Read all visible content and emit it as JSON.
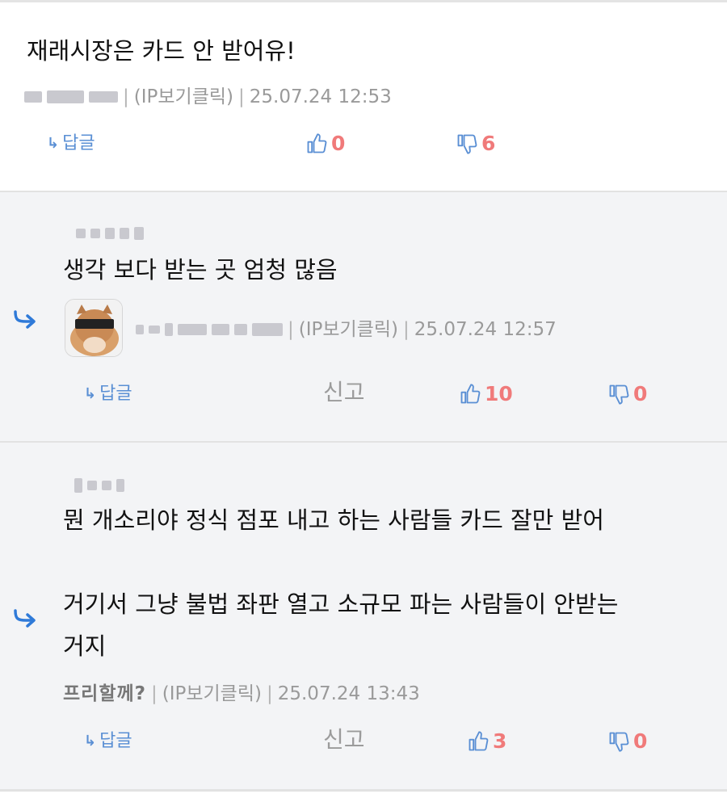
{
  "comments": [
    {
      "text": "재래시장은 카드 안 받어유!",
      "ip": "(IP보기클릭)",
      "date": "25.07.24 12:53",
      "reply": "답글",
      "likes": "0",
      "dislikes": "6"
    },
    {
      "text": "생각 보다 받는 곳 엄청 많음",
      "ip": "(IP보기클릭)",
      "date": "25.07.24 12:57",
      "reply": "답글",
      "report": "신고",
      "likes": "10",
      "dislikes": "0"
    },
    {
      "line1": "뭔 개소리야 정식 점포 내고 하는 사람들 카드 잘만 받어",
      "line2": "거기서 그냥 불법 좌판 열고 소규모 파는 사람들이 안받는",
      "line3": "거지",
      "author": "프리할께?",
      "ip": "(IP보기클릭)",
      "date": "25.07.24 13:43",
      "reply": "답글",
      "report": "신고",
      "likes": "3",
      "dislikes": "0"
    }
  ],
  "icons": {
    "reply_arrow": "reply-arrow-icon",
    "thumbs_up": "thumbs-up-icon",
    "thumbs_down": "thumbs-down-icon"
  },
  "colors": {
    "accent": "#5a8fd4",
    "vote_count": "#f07a7a",
    "reply_bg": "#f3f4f6"
  }
}
